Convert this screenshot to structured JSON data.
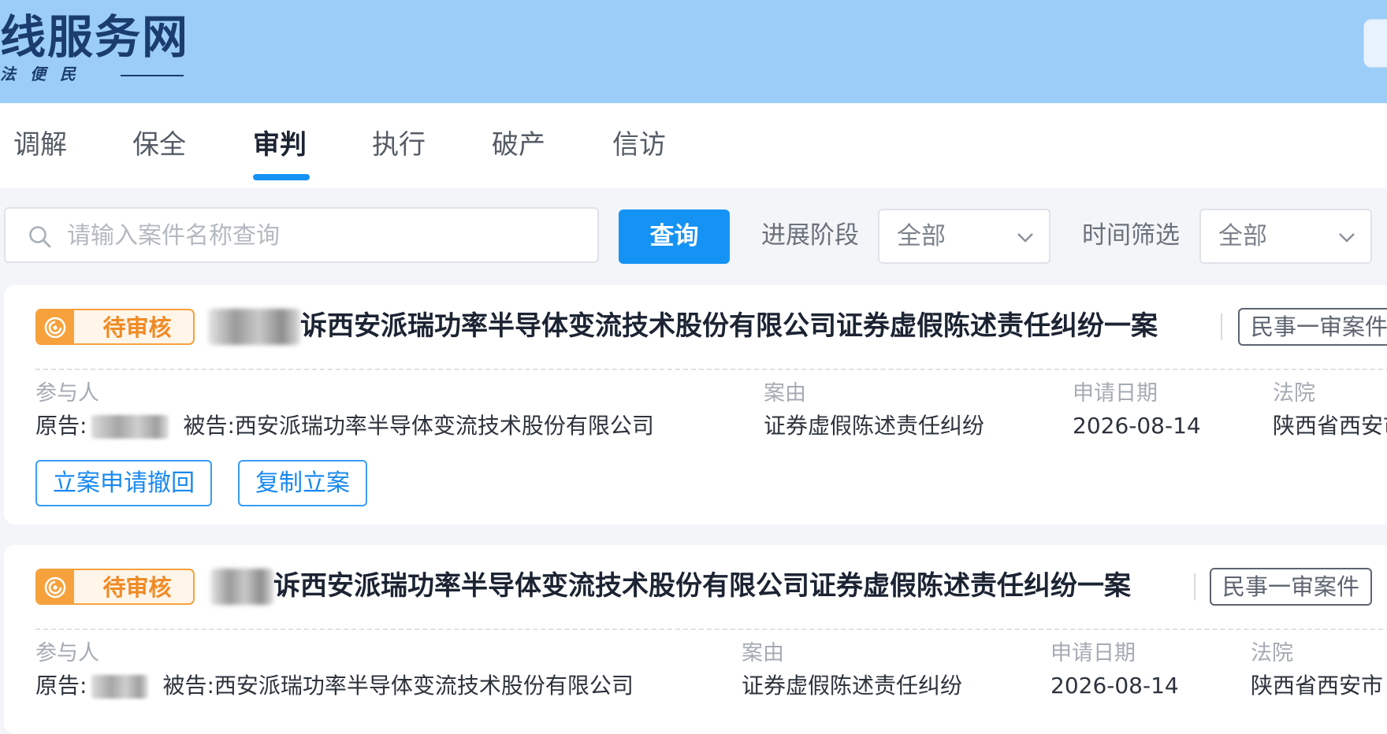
{
  "header": {
    "site_title": "线服务网",
    "slogan": "法便民"
  },
  "tabs": [
    {
      "label": "调解",
      "active": false
    },
    {
      "label": "保全",
      "active": false
    },
    {
      "label": "审判",
      "active": true
    },
    {
      "label": "执行",
      "active": false
    },
    {
      "label": "破产",
      "active": false
    },
    {
      "label": "信访",
      "active": false
    }
  ],
  "search": {
    "placeholder": "请输入案件名称查询",
    "value": "",
    "button_label": "查询"
  },
  "filters": {
    "stage_label": "进展阶段",
    "stage_value": "全部",
    "time_label": "时间筛选",
    "time_value": "全部"
  },
  "field_labels": {
    "participants": "参与人",
    "cause": "案由",
    "apply_date": "申请日期",
    "court": "法院"
  },
  "cases": [
    {
      "status": "待审核",
      "title": "诉西安派瑞功率半导体变流技术股份有限公司证券虚假陈述责任纠纷一案",
      "case_type": "民事一审案件",
      "plaintiff_label": "原告:",
      "defendant_label": "被告:",
      "defendant": "西安派瑞功率半导体变流技术股份有限公司",
      "cause": "证券虚假陈述责任纠纷",
      "apply_date": "2026-08-14",
      "court": "陕西省西安市",
      "actions": [
        "立案申请撤回",
        "复制立案"
      ]
    },
    {
      "status": "待审核",
      "title": "诉西安派瑞功率半导体变流技术股份有限公司证券虚假陈述责任纠纷一案",
      "case_type": "民事一审案件",
      "plaintiff_label": "原告:",
      "defendant_label": "被告:",
      "defendant": "西安派瑞功率半导体变流技术股份有限公司",
      "cause": "证券虚假陈述责任纠纷",
      "apply_date": "2026-08-14",
      "court": "陕西省西安市"
    }
  ],
  "colors": {
    "banner": "#9ccdf9",
    "accent": "#1593f5",
    "status_orange": "#f6a13c"
  },
  "icons": {
    "search": "search-icon",
    "dropdown": "chevron-down-icon",
    "status": "clock-icon"
  }
}
